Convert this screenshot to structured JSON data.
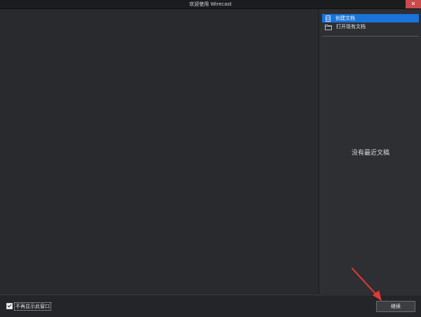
{
  "window": {
    "title": "欢迎使用 Wirecast",
    "close_glyph": "✕"
  },
  "panel": {
    "menu": [
      {
        "label": "创建文档",
        "icon": "new-document-icon",
        "selected": true
      },
      {
        "label": "打开现有文档",
        "icon": "folder-icon",
        "selected": false
      }
    ],
    "recent_empty": "没有最近文稿"
  },
  "footer": {
    "checkbox_label": "不再显示此窗口",
    "checkbox_checked": true,
    "continue_label": "继续"
  },
  "colors": {
    "accent": "#1a73d8",
    "close": "#c84a4a",
    "annotation_arrow": "#e53935"
  }
}
